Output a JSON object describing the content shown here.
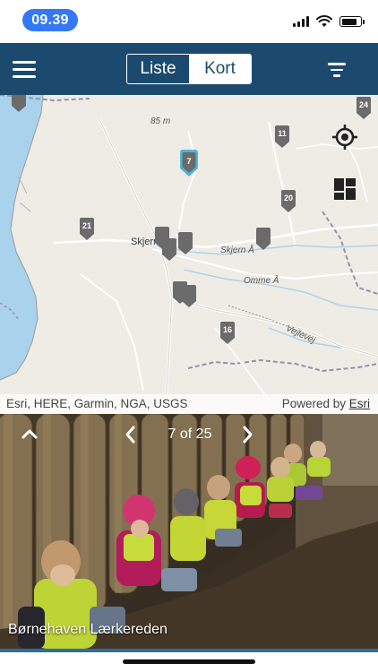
{
  "status_bar": {
    "time": "09.39",
    "battery_level": 0.85
  },
  "app_bar": {
    "tabs": [
      {
        "label": "Liste",
        "selected": false
      },
      {
        "label": "Kort",
        "selected": true
      }
    ],
    "menu_icon": "hamburger-menu-icon",
    "filter_icon": "filter-icon"
  },
  "map": {
    "place_labels": [
      "Skjern",
      "85 m",
      "Skjern Å",
      "Omme Å",
      "Vejlevej"
    ],
    "markers": [
      {
        "label": "",
        "selected": false
      },
      {
        "label": "24",
        "selected": false
      },
      {
        "label": "11",
        "selected": false
      },
      {
        "label": "7",
        "selected": true
      },
      {
        "label": "20",
        "selected": false
      },
      {
        "label": "21",
        "selected": false
      },
      {
        "label": "",
        "selected": false
      },
      {
        "label": "",
        "selected": false
      },
      {
        "label": "",
        "selected": false
      },
      {
        "label": "",
        "selected": false
      },
      {
        "label": "",
        "selected": false
      },
      {
        "label": "",
        "selected": false
      },
      {
        "label": "16",
        "selected": false
      }
    ],
    "locate_icon": "crosshair-locate-icon",
    "basemap_icon": "basemap-gallery-icon",
    "attribution": "Esri, HERE, Garmin, NGA, USGS",
    "powered_by": "Powered by",
    "powered_by_link": "Esri"
  },
  "photo_panel": {
    "counter": "7 of 25",
    "caption": "Børnehaven Lærkereden",
    "collapse_icon": "chevron-up-icon",
    "prev_icon": "chevron-left-icon",
    "next_icon": "chevron-right-icon"
  },
  "colors": {
    "app_bar": "#1b4a6e",
    "time_pill": "#3478f6",
    "marker": "#6b6b6b",
    "marker_selected": "#4fb6d9",
    "water": "#a9d3ec"
  }
}
